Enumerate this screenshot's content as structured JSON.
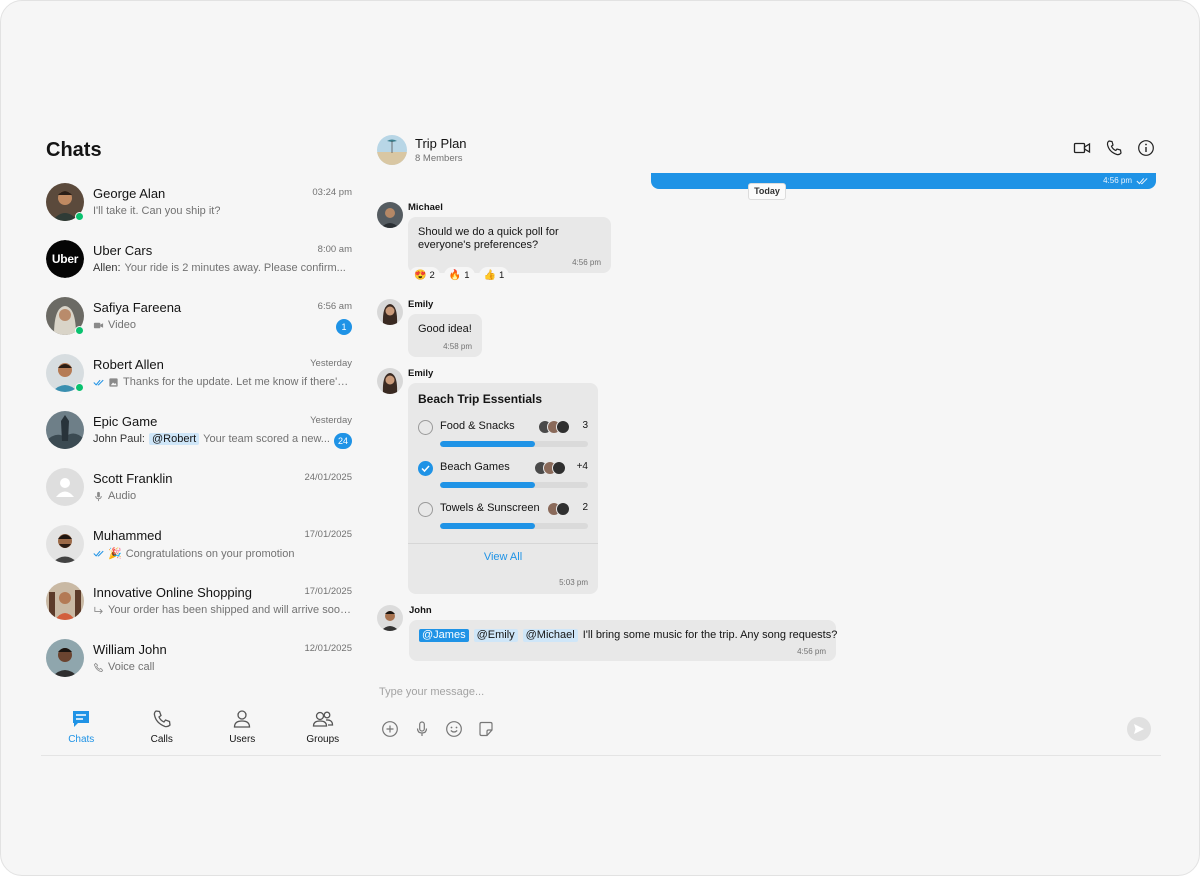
{
  "sidebar": {
    "title": "Chats",
    "chats": [
      {
        "name": "George Alan",
        "time": "03:24 pm",
        "preview": "I'll take it. Can you ship it?",
        "online": true
      },
      {
        "name": "Uber Cars",
        "time": "8:00 am",
        "sender": "Allen:",
        "preview": "Your ride is 2 minutes away. Please confirm...",
        "logo_text": "Uber"
      },
      {
        "name": "Safiya Fareena",
        "time": "6:56 am",
        "preview": "Video",
        "badge": "1",
        "online": true,
        "icon": "video-icon"
      },
      {
        "name": "Robert Allen",
        "time": "Yesterday",
        "preview": "Thanks for the update. Let me know if there's...",
        "online": true,
        "icon": "image-icon",
        "receipt": "double-check-icon"
      },
      {
        "name": "Epic Game",
        "time": "Yesterday",
        "sender": "John Paul:",
        "mention": "@Robert",
        "preview": "Your team scored a new...",
        "badge": "24"
      },
      {
        "name": "Scott Franklin",
        "time": "24/01/2025",
        "preview": "Audio",
        "icon": "mic-icon"
      },
      {
        "name": "Muhammed",
        "time": "17/01/2025",
        "preview": "Congratulations on your promotion",
        "emoji": "🎉",
        "receipt": "double-check-icon"
      },
      {
        "name": "Innovative Online Shopping",
        "time": "17/01/2025",
        "preview": "Your order has been shipped and will arrive soon...",
        "icon": "reply-arrow-icon"
      },
      {
        "name": "William John",
        "time": "12/01/2025",
        "preview": "Voice call",
        "icon": "phone-incoming-icon"
      }
    ]
  },
  "nav": {
    "items": [
      {
        "label": "Chats",
        "icon": "chat-icon",
        "active": true
      },
      {
        "label": "Calls",
        "icon": "phone-icon",
        "active": false
      },
      {
        "label": "Users",
        "icon": "user-icon",
        "active": false
      },
      {
        "label": "Groups",
        "icon": "group-icon",
        "active": false
      }
    ]
  },
  "conversation": {
    "group_name": "Trip Plan",
    "members": "8 Members",
    "header_icons": [
      "video-call-icon",
      "voice-call-icon",
      "info-icon"
    ],
    "last_sent_time": "4:56 pm",
    "date_divider": "Today",
    "messages": [
      {
        "sender": "Michael",
        "text_line1": "Should we do a quick poll for",
        "text_line2": "everyone's preferences?",
        "time": "4:56 pm",
        "reactions": [
          {
            "emoji": "😍",
            "count": "2"
          },
          {
            "emoji": "🔥",
            "count": "1"
          },
          {
            "emoji": "👍",
            "count": "1"
          }
        ]
      },
      {
        "sender": "Emily",
        "text": "Good idea!",
        "time": "4:58 pm"
      },
      {
        "sender": "Emily",
        "time": "5:03 pm",
        "poll": {
          "title": "Beach Trip Essentials",
          "options": [
            {
              "label": "Food & Snacks",
              "count": "3",
              "checked": false,
              "fraction": 0.64
            },
            {
              "label": "Beach Games",
              "count": "+4",
              "checked": true,
              "fraction": 0.64
            },
            {
              "label": "Towels & Sunscreen",
              "count": "2",
              "checked": false,
              "fraction": 0.64
            }
          ],
          "view_all": "View All"
        }
      },
      {
        "sender": "John",
        "mentions": [
          "@James",
          "@Emily",
          "@Michael"
        ],
        "text": "I'll bring some music for the trip. Any song requests?",
        "time": "4:56 pm"
      }
    ]
  },
  "composer": {
    "placeholder": "Type your message...",
    "icons": [
      "add-icon",
      "mic-icon",
      "emoji-icon",
      "sticker-icon"
    ],
    "send_icon": "send-icon"
  },
  "colors": {
    "accent": "#1f93e6",
    "background": "#f6f6f6",
    "bubble": "#e8e8e8",
    "online": "#09c26f"
  }
}
